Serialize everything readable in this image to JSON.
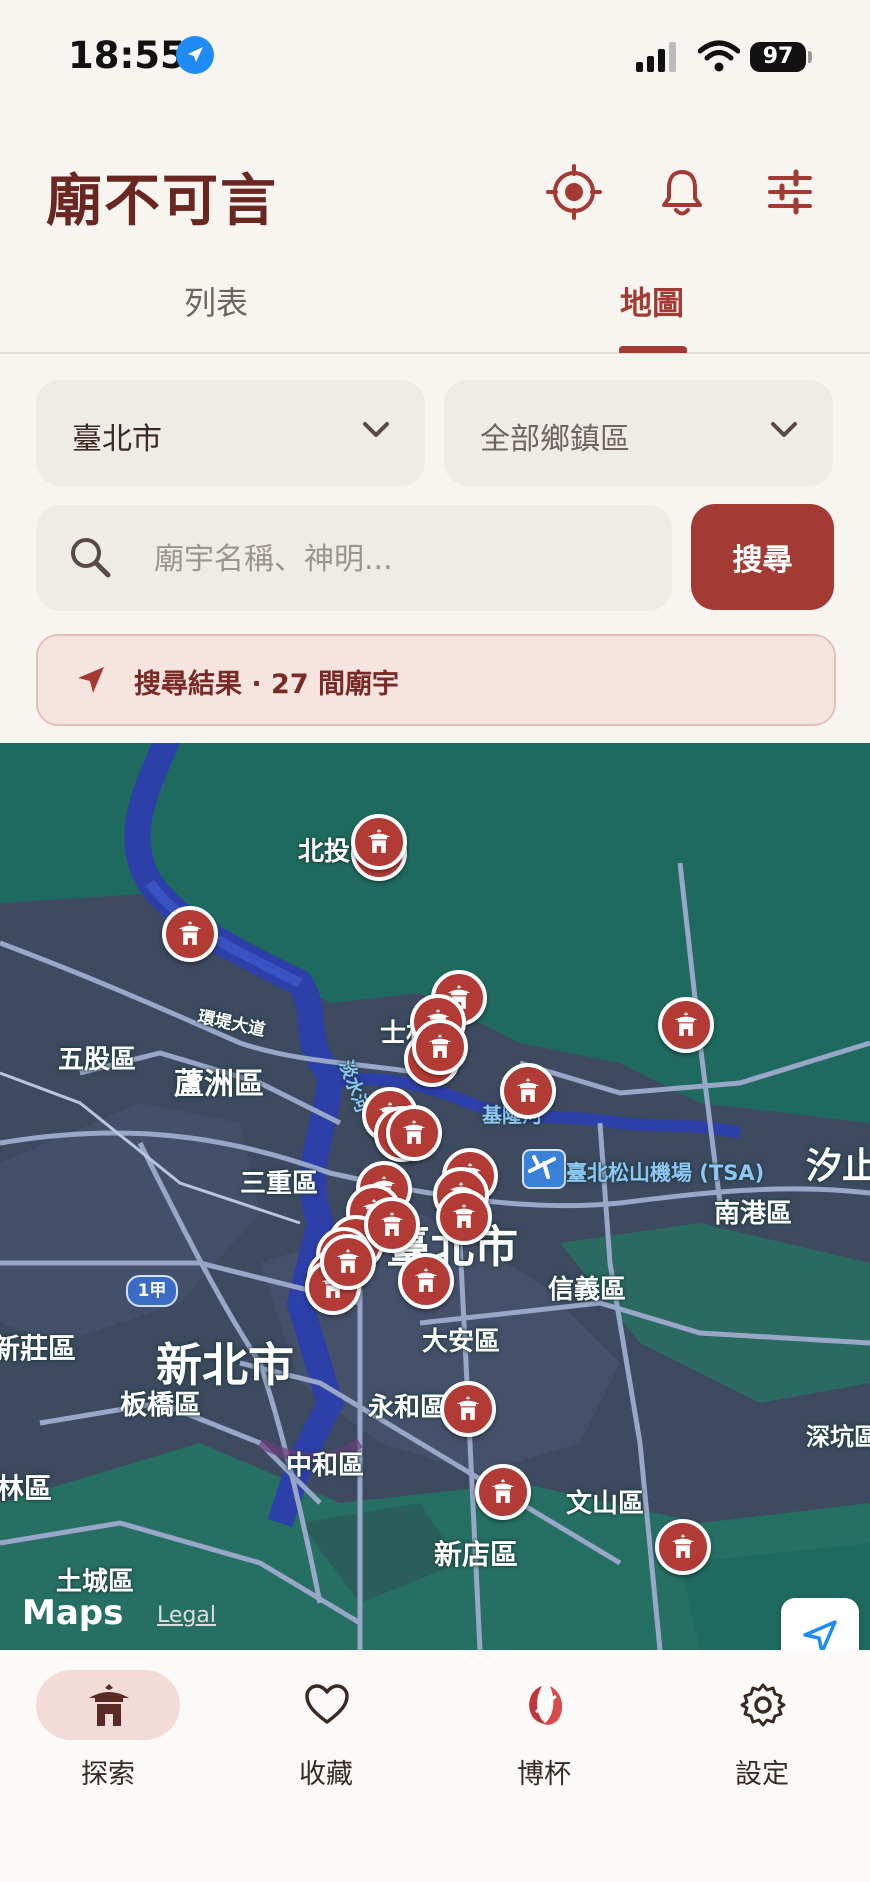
{
  "status_bar": {
    "time": "18:55",
    "battery": "97"
  },
  "app": {
    "title": "廟不可言"
  },
  "header_icons": [
    "location-target-icon",
    "bell-icon",
    "sliders-icon"
  ],
  "tabs": [
    {
      "label": "列表",
      "active": false
    },
    {
      "label": "地圖",
      "active": true
    }
  ],
  "filters": {
    "city": "臺北市",
    "district": "全部鄉鎮區"
  },
  "search": {
    "placeholder": "廟宇名稱、神明...",
    "value": "",
    "button_label": "搜尋"
  },
  "result_banner": {
    "text": "搜尋結果 · 27 間廟宇"
  },
  "map": {
    "labels": {
      "beitou": "北投區",
      "shilin": "士林區",
      "wugu": "五股區",
      "luzhou": "蘆洲區",
      "ring_road": "環堤大道",
      "tamsui_river": "淡水河",
      "keelung_river": "基隆河",
      "airport": "臺北松山機場 (TSA)",
      "xizhi": "汐止",
      "sanchong": "三重區",
      "taipei_city": "臺北市",
      "nangang": "南港區",
      "xinyi": "信義區",
      "route": "1甲",
      "xinzhuang": "新莊區",
      "new_taipei": "新北市",
      "daan": "大安區",
      "banqiao": "板橋區",
      "yonghe": "永和區",
      "zhonghe": "中和區",
      "shenkeng": "深坑區",
      "linkou": "林區",
      "wenshan": "文山區",
      "tucheng": "土城區",
      "xindian": "新店區"
    },
    "attribution": "Maps",
    "legal": "Legal"
  },
  "bottom_nav": [
    {
      "label": "探索",
      "icon": "temple-icon",
      "active": true
    },
    {
      "label": "收藏",
      "icon": "heart-icon",
      "active": false
    },
    {
      "label": "博杯",
      "icon": "moon-blocks-icon",
      "active": false
    },
    {
      "label": "設定",
      "icon": "gear-icon",
      "active": false
    }
  ],
  "colors": {
    "accent": "#a33a33",
    "title": "#6a2620",
    "map_green": "#1f6a5e",
    "pin": "#b33b36"
  }
}
